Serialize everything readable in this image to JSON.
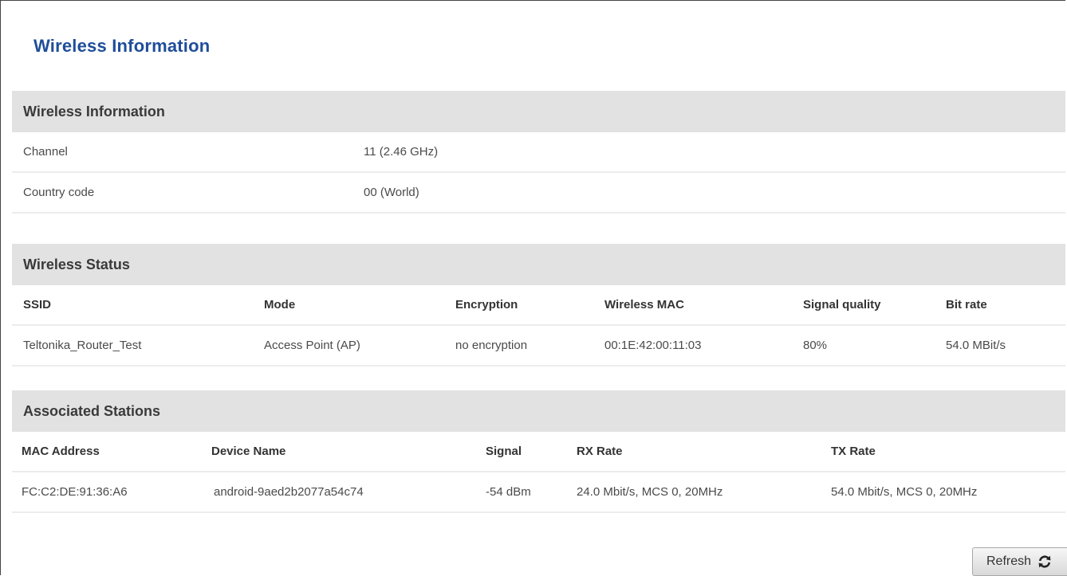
{
  "page": {
    "title": "Wireless Information"
  },
  "wireless_info": {
    "header": "Wireless Information",
    "rows": [
      {
        "label": "Channel",
        "value": "11 (2.46 GHz)"
      },
      {
        "label": "Country code",
        "value": "00 (World)"
      }
    ]
  },
  "wireless_status": {
    "header": "Wireless Status",
    "columns": [
      "SSID",
      "Mode",
      "Encryption",
      "Wireless MAC",
      "Signal quality",
      "Bit rate"
    ],
    "rows": [
      [
        "Teltonika_Router_Test",
        "Access Point (AP)",
        "no encryption",
        "00:1E:42:00:11:03",
        "80%",
        "54.0 MBit/s"
      ]
    ]
  },
  "associated_stations": {
    "header": "Associated Stations",
    "columns": [
      "MAC Address",
      "Device Name",
      "Signal",
      "RX Rate",
      "TX Rate"
    ],
    "rows": [
      [
        "FC:C2:DE:91:36:A6",
        "android-9aed2b2077a54c74",
        "-54 dBm",
        "24.0 Mbit/s, MCS 0, 20MHz",
        "54.0 Mbit/s, MCS 0, 20MHz"
      ]
    ]
  },
  "actions": {
    "refresh_label": "Refresh",
    "refresh_icon": "refresh-icon"
  }
}
